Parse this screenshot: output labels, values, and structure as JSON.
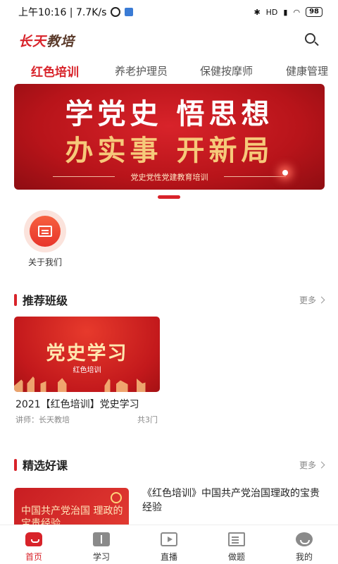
{
  "status_bar": {
    "time_speed": "上午10:16 | 7.7K/s",
    "network": "HD",
    "battery": "98"
  },
  "header": {
    "logo_part1": "长天",
    "logo_part2": "教培",
    "search_icon": "search-icon"
  },
  "tabs": [
    {
      "label": "红色培训",
      "active": true
    },
    {
      "label": "养老护理员",
      "active": false
    },
    {
      "label": "保健按摩师",
      "active": false
    },
    {
      "label": "健康管理",
      "active": false
    }
  ],
  "banner": {
    "line1": "学党史 悟思想",
    "line2": "办实事 开新局",
    "subtitle": "党史党性党建教育培训"
  },
  "quick_entries": [
    {
      "label": "关于我们",
      "icon": "certificate-icon"
    }
  ],
  "recommended": {
    "title": "推荐班级",
    "more": "更多",
    "courses": [
      {
        "image_title": "党史学习",
        "image_subtitle": "红色培训",
        "title": "2021【红色培训】党史学习",
        "teacher": "讲师：长天教培",
        "count": "共3门"
      }
    ]
  },
  "featured": {
    "title": "精选好课",
    "more": "更多",
    "courses": [
      {
        "image_text": "中国共产党治国 理政的宝贵经验",
        "title": "《红色培训》中国共产党治国理政的宝贵经验"
      }
    ]
  },
  "bottom_nav": [
    {
      "label": "首页",
      "icon": "home-icon",
      "active": true
    },
    {
      "label": "学习",
      "icon": "book-icon",
      "active": false
    },
    {
      "label": "直播",
      "icon": "live-tv-icon",
      "active": false
    },
    {
      "label": "做题",
      "icon": "quiz-icon",
      "active": false
    },
    {
      "label": "我的",
      "icon": "profile-icon",
      "active": false
    }
  ],
  "colors": {
    "accent": "#d8232a"
  }
}
